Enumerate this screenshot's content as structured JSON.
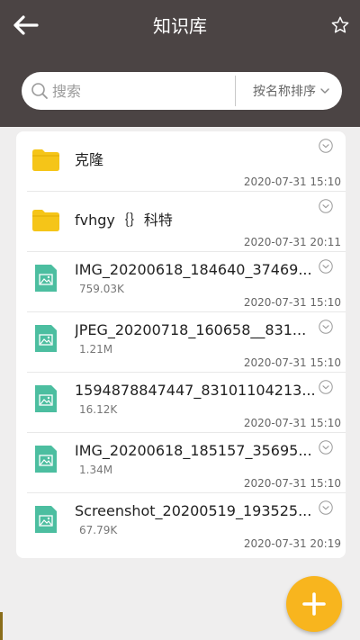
{
  "header": {
    "title": "知识库",
    "back_icon": "back-arrow-icon",
    "star_icon": "star-outline-icon"
  },
  "search": {
    "placeholder": "搜索",
    "value": "",
    "sort_label": "按名称排序"
  },
  "colors": {
    "header_bg": "#4b4444",
    "accent": "#f8b51e",
    "folder": "#f5c518",
    "image_icon": "#4cbea0"
  },
  "files": [
    {
      "type": "folder",
      "name": "克隆",
      "size": "",
      "date": "2020-07-31 15:10"
    },
    {
      "type": "folder",
      "name": "fvhgy｛｝科特",
      "size": "",
      "date": "2020-07-31 20:11"
    },
    {
      "type": "image",
      "name": "IMG_20200618_184640_37469...",
      "size": "759.03K",
      "date": "2020-07-31 15:10"
    },
    {
      "type": "image",
      "name": "JPEG_20200718_160658__831...",
      "size": "1.21M",
      "date": "2020-07-31 15:10"
    },
    {
      "type": "image",
      "name": "1594878847447_83101104213...",
      "size": "16.12K",
      "date": "2020-07-31 15:10"
    },
    {
      "type": "image",
      "name": "IMG_20200618_185157_35695...",
      "size": "1.34M",
      "date": "2020-07-31 15:10"
    },
    {
      "type": "image",
      "name": "Screenshot_20200519_193525...",
      "size": "67.79K",
      "date": "2020-07-31 20:19"
    }
  ],
  "fab": {
    "icon": "plus-icon"
  }
}
